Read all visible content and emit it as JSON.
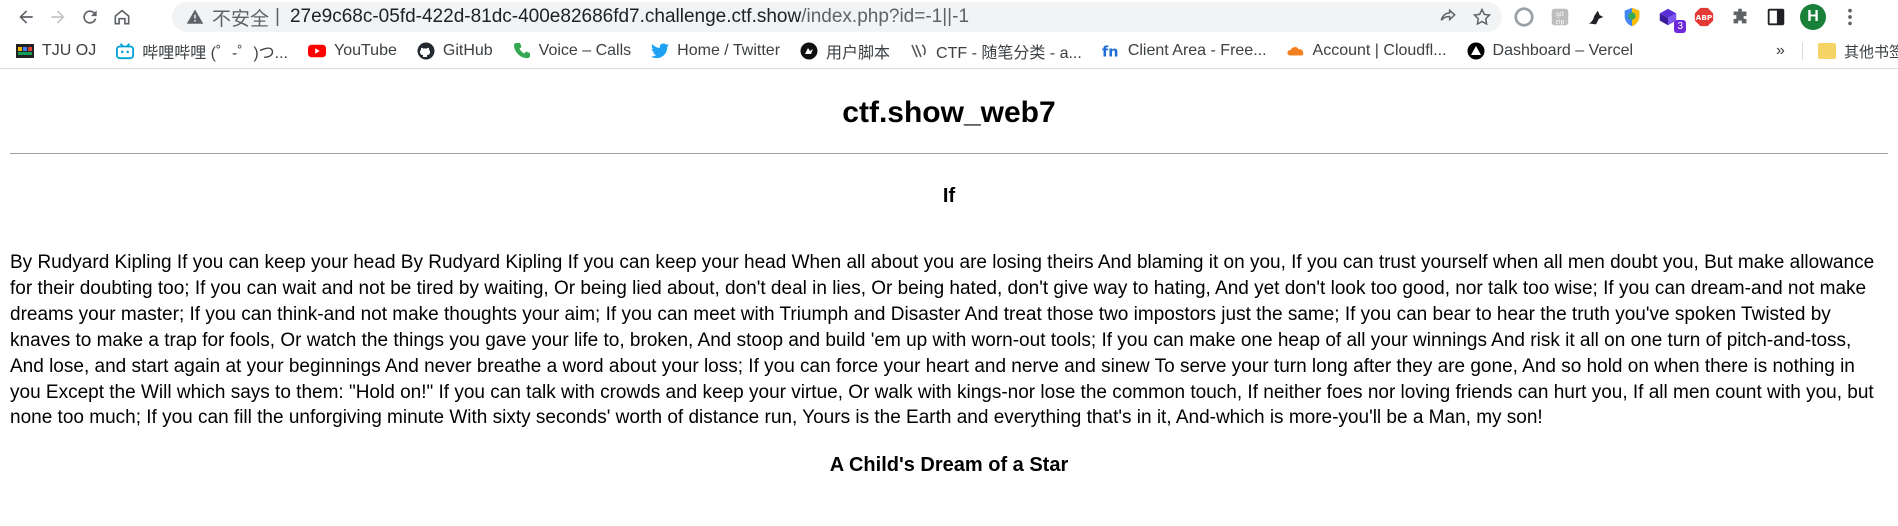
{
  "browser": {
    "security_label": "不安全",
    "url_host": "27e9c68c-05fd-422d-81dc-400e82686fd7.challenge.ctf.show",
    "url_path": "/index.php?id=-1||-1",
    "extensions": [
      "chrome-circle-icon",
      "gitzip-icon",
      "tampermonkey-bird-icon",
      "shield-icon",
      "puzzle-cube-icon",
      "adblock-icon",
      "extensions-puzzle-icon",
      "side-panel-icon"
    ],
    "extension_badge": "3",
    "profile_initial": "H"
  },
  "bookmarks": [
    {
      "label": "TJU OJ",
      "icon": "tju-icon"
    },
    {
      "label": "哔哩哔哩 (゜-゜)つ...",
      "icon": "bilibili-icon"
    },
    {
      "label": "YouTube",
      "icon": "youtube-icon"
    },
    {
      "label": "GitHub",
      "icon": "github-icon"
    },
    {
      "label": "Voice – Calls",
      "icon": "phone-icon"
    },
    {
      "label": "Home / Twitter",
      "icon": "twitter-icon"
    },
    {
      "label": "用户脚本",
      "icon": "userscript-icon"
    },
    {
      "label": "CTF - 随笔分类 - a...",
      "icon": "cnblogs-icon"
    },
    {
      "label": "Client Area - Free...",
      "icon": "fn-icon"
    },
    {
      "label": "Account | Cloudfl...",
      "icon": "cloudflare-icon"
    },
    {
      "label": "Dashboard – Vercel",
      "icon": "vercel-icon"
    }
  ],
  "bookmarks_more": "»",
  "bookmarks_other": "其他书签",
  "page": {
    "title": "ctf.show_web7",
    "article_title": "If",
    "article_body": "By Rudyard Kipling If you can keep your head By Rudyard Kipling If you can keep your head When all about you are losing theirs And blaming it on you, If you can trust yourself when all men doubt you, But make allowance for their doubting too; If you can wait and not be tired by waiting, Or being lied about, don't deal in lies, Or being hated, don't give way to hating, And yet don't look too good, nor talk too wise; If you can dream-and not make dreams your master; If you can think-and not make thoughts your aim; If you can meet with Triumph and Disaster And treat those two impostors just the same; If you can bear to hear the truth you've spoken Twisted by knaves to make a trap for fools, Or watch the things you gave your life to, broken, And stoop and build 'em up with worn-out tools; If you can make one heap of all your winnings And risk it all on one turn of pitch-and-toss, And lose, and start again at your beginnings And never breathe a word about your loss; If you can force your heart and nerve and sinew To serve your turn long after they are gone, And so hold on when there is nothing in you Except the Will which says to them: \"Hold on!\" If you can talk with crowds and keep your virtue, Or walk with kings-nor lose the common touch, If neither foes nor loving friends can hurt you, If all men count with you, but none too much; If you can fill the unforgiving minute With sixty seconds' worth of distance run, Yours is the Earth and everything that's in it, And-which is more-you'll be a Man, my son!",
    "next_article_title": "A Child's Dream of a Star"
  }
}
